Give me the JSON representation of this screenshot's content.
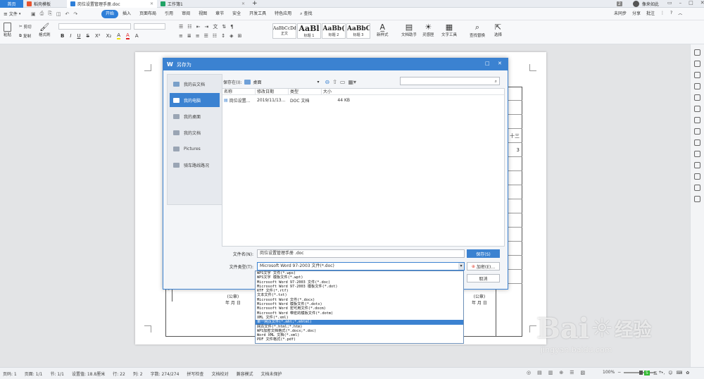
{
  "tabs": {
    "home": "首页",
    "items": [
      {
        "label": "稻壳模板",
        "color": "#e8532e"
      },
      {
        "label": "岗位设置管理手册.doc",
        "color": "#2f7fd8"
      },
      {
        "label": "工作簿1",
        "color": "#21a366"
      }
    ],
    "add": "+",
    "badge": "2",
    "user": "像来如此"
  },
  "menubar": {
    "file": "文件",
    "items": [
      "开始",
      "插入",
      "页面布局",
      "引用",
      "审阅",
      "视图",
      "章节",
      "安全",
      "开发工具",
      "特色应用"
    ],
    "active": "开始",
    "search": "查找",
    "right": [
      "未同步",
      "分享",
      "批注"
    ]
  },
  "toolbar": {
    "cut": "剪切",
    "copy": "复制",
    "format_painter": "格式刷",
    "paste": "粘贴",
    "styles": [
      {
        "preview": "AaBbCcDd",
        "name": "正文"
      },
      {
        "preview": "AaBl",
        "name": "标题 1"
      },
      {
        "preview": "AaBb(",
        "name": "标题 2"
      },
      {
        "preview": "AaBbC",
        "name": "标题 3"
      }
    ],
    "new_style": "新样式",
    "doc_helper": "文档助手",
    "inspiration": "灵感匣",
    "text_tools": "文字工具",
    "find_replace": "查找替换",
    "select": "选择"
  },
  "dialog": {
    "title": "另存为",
    "save_in_label": "保存在(I):",
    "save_in_value": "桌面",
    "sidebar": [
      "我的云文档",
      "我的电脑",
      "我的桌面",
      "我的文档",
      "Pictures",
      "骑车路线路况"
    ],
    "sidebar_selected": 1,
    "columns": [
      "名称",
      "修改日期",
      "类型",
      "大小"
    ],
    "files": [
      {
        "name": "岗位设置...",
        "date": "2019/11/13...",
        "type": "DOC 文档",
        "size": "44 KB"
      }
    ],
    "filename_label": "文件名(N):",
    "filename_value": "岗位设置管理手册 .doc",
    "filetype_label": "文件类型(T):",
    "filetype_value": "Microsoft Word 97-2003 文件(*.doc)",
    "save_button": "保存(S)",
    "encrypt_button": "加密(E)...",
    "cancel_button": "取消",
    "filetype_options": [
      "WPS文字 文件(*.wps)",
      "WPS文字 模板文件(*.wpt)",
      "Microsoft Word 97-2003 文件(*.doc)",
      "Microsoft Word 97-2003 模板文件(*.dot)",
      "RTF 文件(*.rtf)",
      "文本文件(*.txt)",
      "Microsoft Word 文件(*.docx)",
      "Microsoft Word 模板文件(*.dotx)",
      "Microsoft Word 宏可用文件(*.docm)",
      "Microsoft Word 带宏的模板文件(*.dotm)",
      "XML 文件(*.xml)",
      "单一网页文件(*.mht;*.mhtml)",
      "网页文件(*.html;*.htm)",
      "WPS加密文档格式(*.docx;*.doc)",
      "Word XML 文档(*.xml)",
      "PDF 文件格式(*.pdf)"
    ],
    "highlighted_option": 11
  },
  "document": {
    "table_right_cells": [
      "十三",
      "3"
    ],
    "footer_left": "(公章)",
    "footer_left_date": "年  月  日",
    "footer_right": "(公章)",
    "footer_right_date": "年  月  日"
  },
  "statusbar": {
    "items": [
      "页码: 1",
      "页面: 1/1",
      "节: 1/1",
      "设置值: 18.8厘米",
      "行: 22",
      "列: 2",
      "字数: 274/274",
      "拼写检查",
      "文档校对",
      "兼容模式",
      "文档未保护"
    ],
    "zoom": "100%",
    "ime": "五"
  },
  "watermark": {
    "brand": "Bai",
    "brand_suffix": "经验",
    "url": "jingyan.baidu.com"
  }
}
